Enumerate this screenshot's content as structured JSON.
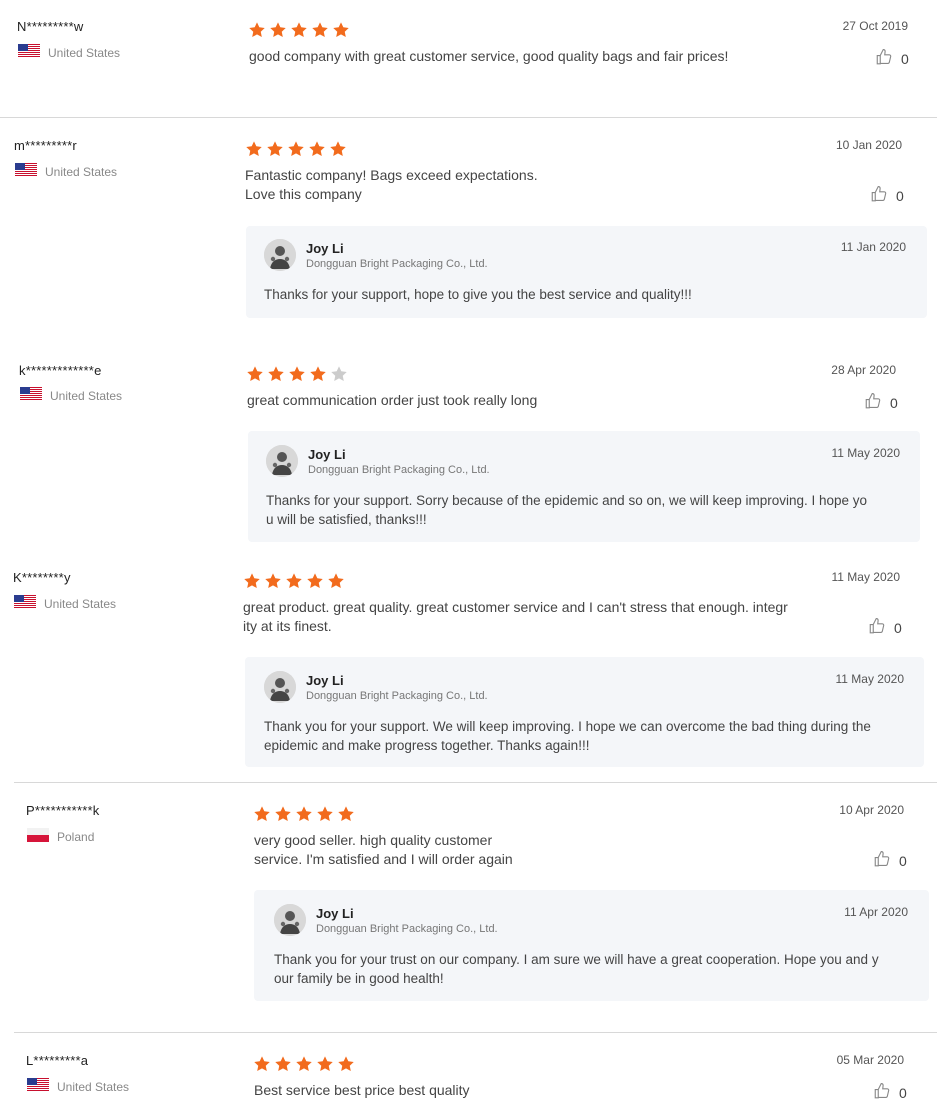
{
  "colors": {
    "star_filled": "#f26b1d",
    "star_empty": "#cccccc",
    "reply_bg": "#f4f6f9"
  },
  "reviews": [
    {
      "user": "N*********w",
      "country": "United States",
      "flag": "us-flag-icon",
      "rating": 5,
      "date": "27 Oct 2019",
      "text": "good company with great customer service, good quality bags and fair prices!",
      "likes": "0"
    },
    {
      "user": "m*********r",
      "country": "United States",
      "flag": "us-flag-icon",
      "rating": 5,
      "date": "10 Jan 2020",
      "text": "Fantastic company! Bags exceed expectations.\nLove this company",
      "likes": "0",
      "reply": {
        "name": "Joy Li",
        "company": "Dongguan Bright Packaging Co., Ltd.",
        "date": "11 Jan 2020",
        "text": "Thanks for your support, hope to give you the best service and quality!!!"
      }
    },
    {
      "user": "k*************e",
      "country": "United States",
      "flag": "us-flag-icon",
      "rating": 4,
      "date": "28 Apr 2020",
      "text": "great communication order just took really long",
      "likes": "0",
      "reply": {
        "name": "Joy Li",
        "company": "Dongguan Bright Packaging Co., Ltd.",
        "date": "11 May 2020",
        "text": "Thanks for your support. Sorry because of the epidemic and so on, we will keep improving. I hope yo\nu will be satisfied, thanks!!!"
      }
    },
    {
      "user": "K********y",
      "country": "United States",
      "flag": "us-flag-icon",
      "rating": 5,
      "date": "11 May 2020",
      "text": "great product. great quality. great customer service and I can't stress that enough. integr\nity at its finest.",
      "likes": "0",
      "reply": {
        "name": "Joy Li",
        "company": "Dongguan Bright Packaging Co., Ltd.",
        "date": "11 May 2020",
        "text": "Thank you for your support. We will keep improving. I hope we can overcome the bad thing during the\nepidemic and make progress together. Thanks again!!!"
      }
    },
    {
      "user": "P***********k",
      "country": "Poland",
      "flag": "poland-flag-icon",
      "rating": 5,
      "date": "10 Apr 2020",
      "text": "very good seller. high quality customer\nservice. I'm satisfied and I will order again",
      "likes": "0",
      "reply": {
        "name": "Joy Li",
        "company": "Dongguan Bright Packaging Co., Ltd.",
        "date": "11 Apr 2020",
        "text": "Thank you for your trust on our company. I am sure we will have a great cooperation. Hope you and y\nour family be in good health!"
      }
    },
    {
      "user": "L*********a",
      "country": "United States",
      "flag": "us-flag-icon",
      "rating": 5,
      "date": "05 Mar 2020",
      "text": "Best service best price best quality",
      "likes": "0"
    }
  ]
}
